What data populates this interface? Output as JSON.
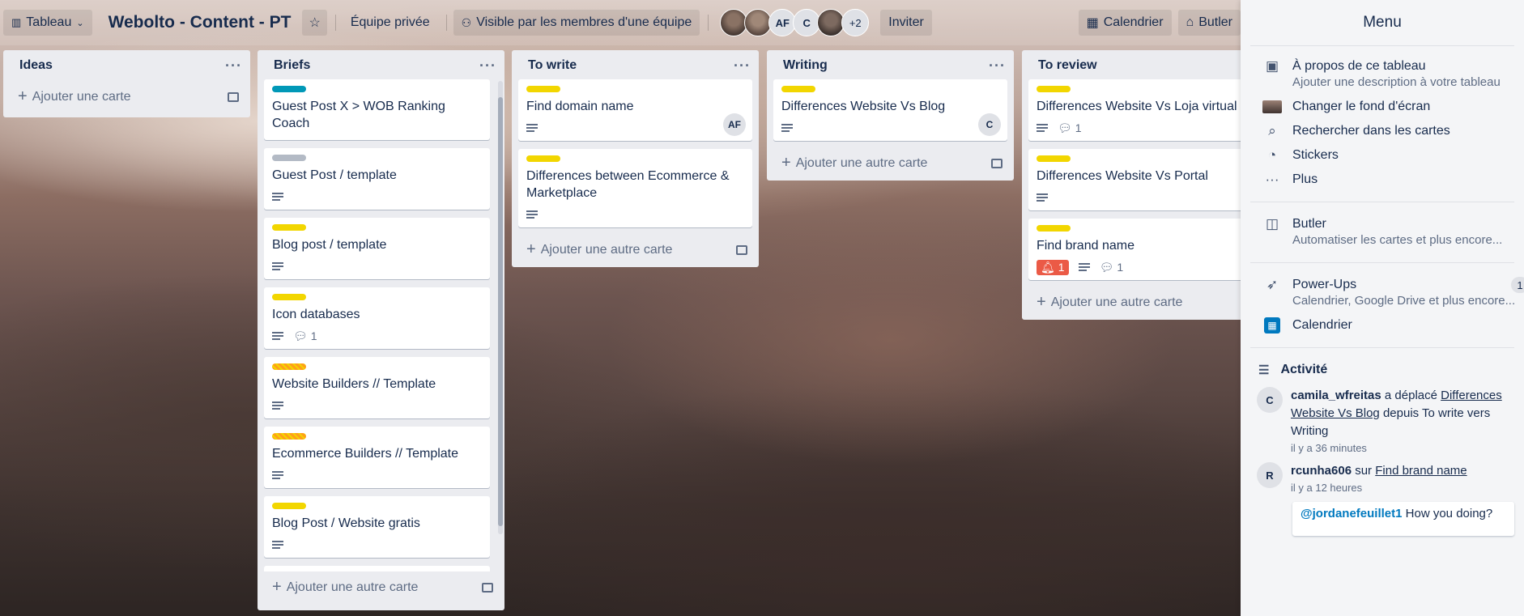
{
  "header": {
    "board_switcher": "Tableau",
    "title": "Webolto - Content - PT",
    "team": "Équipe privée",
    "visibility": "Visible par les membres d'une équipe",
    "members": [
      "",
      "",
      "AF",
      "C",
      "",
      "+2"
    ],
    "invite": "Inviter",
    "calendar": "Calendrier",
    "butler": "Butler"
  },
  "lists": [
    {
      "title": "Ideas",
      "add_label": "Ajouter une carte",
      "cards": []
    },
    {
      "title": "Briefs",
      "add_label": "Ajouter une autre carte",
      "cards": [
        {
          "title": "Guest Post X > WOB Ranking Coach",
          "label_color": "#0098b7",
          "desc": false,
          "comments": ""
        },
        {
          "title": "Guest Post / template",
          "label_color": "#b3bac5",
          "desc": true,
          "comments": ""
        },
        {
          "title": "Blog post / template",
          "label_color": "#f2d600",
          "desc": true,
          "comments": ""
        },
        {
          "title": "Icon databases",
          "label_color": "#f2d600",
          "desc": true,
          "comments": "1"
        },
        {
          "title": "Website Builders // Template",
          "label_color": "#ff9f1a",
          "desc": true,
          "comments": ""
        },
        {
          "title": "Ecommerce Builders // Template",
          "label_color": "#ff9f1a",
          "desc": true,
          "comments": ""
        },
        {
          "title": "Blog Post / Website gratis",
          "label_color": "#f2d600",
          "desc": true,
          "comments": ""
        }
      ]
    },
    {
      "title": "To write",
      "add_label": "Ajouter une autre carte",
      "cards": [
        {
          "title": "Find domain name",
          "label_color": "#f2d600",
          "desc": true,
          "member": "AF"
        },
        {
          "title": "Differences between Ecommerce & Marketplace",
          "label_color": "#f2d600",
          "desc": true
        }
      ]
    },
    {
      "title": "Writing",
      "add_label": "Ajouter une autre carte",
      "cards": [
        {
          "title": "Differences Website Vs Blog",
          "label_color": "#f2d600",
          "desc": true,
          "member": "C"
        }
      ]
    },
    {
      "title": "To review",
      "add_label": "Ajouter une autre carte",
      "cards": [
        {
          "title": "Differences Website Vs Loja virtual",
          "label_color": "#f2d600",
          "desc": true,
          "comments": "1"
        },
        {
          "title": "Differences Website Vs Portal",
          "label_color": "#f2d600",
          "desc": true
        },
        {
          "title": "Find brand name",
          "label_color": "#f2d600",
          "desc": true,
          "comments": "1",
          "alert": "1"
        }
      ]
    }
  ],
  "menu": {
    "title": "Menu",
    "about_title": "À propos de ce tableau",
    "about_sub": "Ajouter une description à votre tableau",
    "background": "Changer le fond d'écran",
    "search": "Rechercher dans les cartes",
    "stickers": "Stickers",
    "more": "Plus",
    "butler_title": "Butler",
    "butler_sub": "Automatiser les cartes et plus encore...",
    "powerups_title": "Power-Ups",
    "powerups_sub": "Calendrier, Google Drive et plus encore...",
    "powerups_count": "1",
    "calendar": "Calendrier",
    "activity": "Activité",
    "activities": [
      {
        "avatar": "C",
        "user": "camila_wfreitas",
        "verb": "a déplacé",
        "card": "Differences Website Vs Blog",
        "rest": "depuis To write vers Writing",
        "time": "il y a 36 minutes"
      },
      {
        "avatar": "R",
        "user": "rcunha606",
        "verb": "sur",
        "card": "Find brand name",
        "rest": "",
        "time": "il y a 12 heures"
      }
    ],
    "comment_mention": "@jordanefeuillet1",
    "comment_text": " How you doing?"
  }
}
